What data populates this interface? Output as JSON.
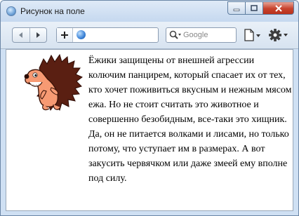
{
  "window": {
    "title": "Рисунок на поле",
    "icon": "browser-icon",
    "buttons": [
      "minimize-icon",
      "maximize-icon",
      "close-icon"
    ]
  },
  "toolbar": {
    "back": "back-icon",
    "forward": "forward-icon",
    "add": "plus-icon",
    "address_value": "",
    "search_placeholder": "Google",
    "page_menu": "page-icon",
    "tools_menu": "gear-icon"
  },
  "content": {
    "image": "hedgehog-image",
    "text": "Ёжики защищены от внешней агрессии колючим панцирем, который спасает их от тех, кто хочет поживиться вкусным и нежным мясом ежа. Но не стоит считать это животное и совершенно безобидным, все-таки это хищник. Да, он не питается волками и лисами, но только потому, что уступает им в размерах. А вот закусить червячком или даже змеей ему вполне под силу."
  },
  "colors": {
    "frame": "#cfe0f3",
    "close_button": "#c7422c",
    "hedgehog_spines": "#5a1f12",
    "hedgehog_body": "#f79a73"
  }
}
